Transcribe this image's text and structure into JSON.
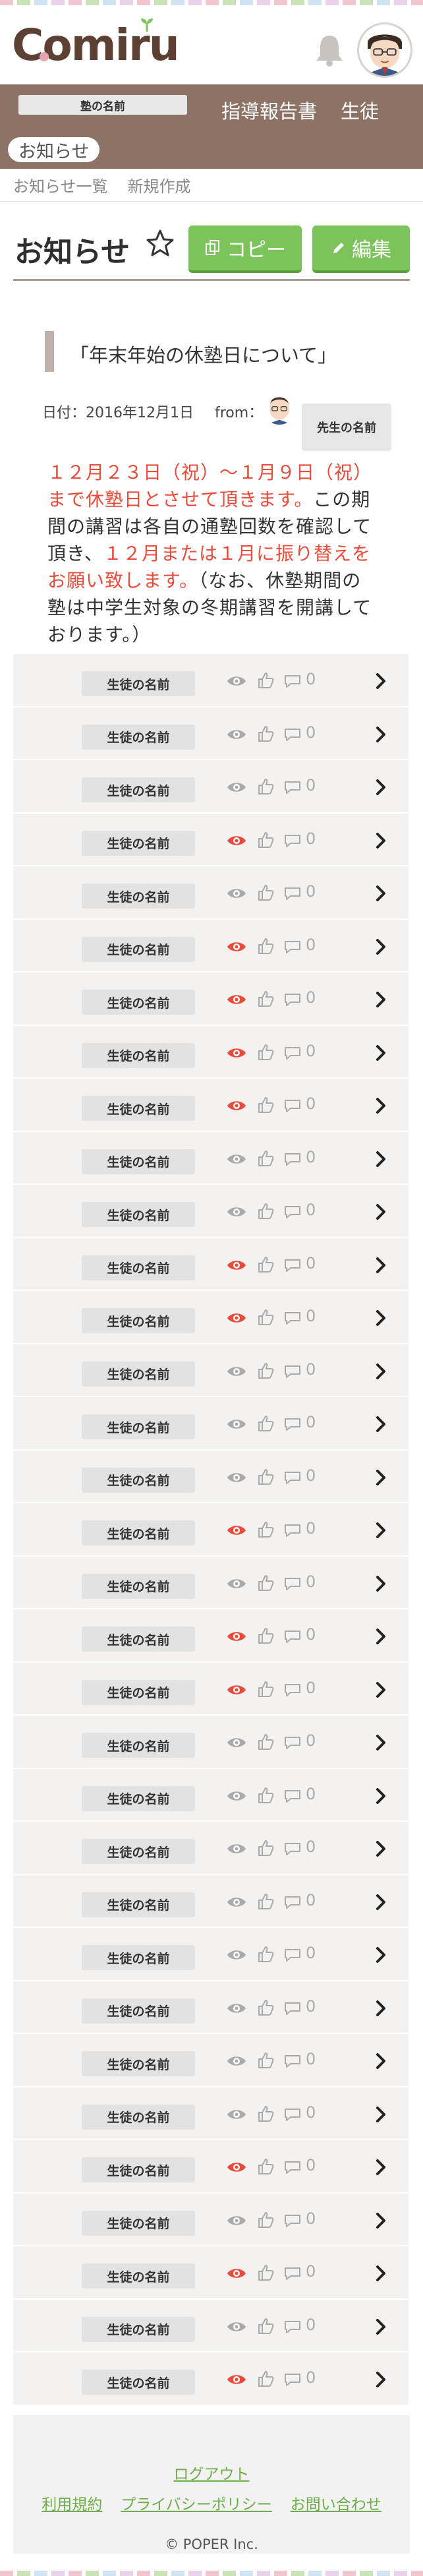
{
  "app": {
    "logo_text": "Comiru",
    "school_name": "塾の名前"
  },
  "nav": {
    "links": [
      "指導報告書",
      "生徒"
    ],
    "active_pill": "お知らせ"
  },
  "subnav": {
    "items": [
      "お知らせ一覧",
      "新規作成"
    ]
  },
  "page": {
    "title": "お知らせ",
    "copy_button": "コピー",
    "edit_button": "編集"
  },
  "notice": {
    "title": "「年末年始の休塾日について」",
    "date": "日付：2016年12月1日",
    "from_label": "from：",
    "teacher_name": "先生の名前",
    "body_red_1": "１２月２３日（祝）〜１月９日（祝）まで休塾日とさせて頂きます。",
    "body_black_1": "この期間の講習は各自の通塾回数を確認して頂き、",
    "body_red_2": "１２月または１月に振り替えをお願い致します。",
    "body_black_2": "（なお、休塾期間の塾は中学生対象の冬期講習を開講しております。）"
  },
  "students": {
    "row_name": "生徒の名前",
    "count_text": "0",
    "colors": {
      "seen": "#e94c3a",
      "unseen": "#aaaaaa"
    },
    "rows": [
      {
        "name": "生徒の名前",
        "seen": false,
        "comments": "0"
      },
      {
        "name": "生徒の名前",
        "seen": false,
        "comments": "0"
      },
      {
        "name": "生徒の名前",
        "seen": false,
        "comments": "0"
      },
      {
        "name": "生徒の名前",
        "seen": true,
        "comments": "0"
      },
      {
        "name": "生徒の名前",
        "seen": false,
        "comments": "0"
      },
      {
        "name": "生徒の名前",
        "seen": true,
        "comments": "0"
      },
      {
        "name": "生徒の名前",
        "seen": true,
        "comments": "0"
      },
      {
        "name": "生徒の名前",
        "seen": true,
        "comments": "0"
      },
      {
        "name": "生徒の名前",
        "seen": true,
        "comments": "0"
      },
      {
        "name": "生徒の名前",
        "seen": false,
        "comments": "0"
      },
      {
        "name": "生徒の名前",
        "seen": false,
        "comments": "0"
      },
      {
        "name": "生徒の名前",
        "seen": true,
        "comments": "0"
      },
      {
        "name": "生徒の名前",
        "seen": true,
        "comments": "0"
      },
      {
        "name": "生徒の名前",
        "seen": false,
        "comments": "0"
      },
      {
        "name": "生徒の名前",
        "seen": false,
        "comments": "0"
      },
      {
        "name": "生徒の名前",
        "seen": false,
        "comments": "0"
      },
      {
        "name": "生徒の名前",
        "seen": true,
        "comments": "0"
      },
      {
        "name": "生徒の名前",
        "seen": false,
        "comments": "0"
      },
      {
        "name": "生徒の名前",
        "seen": true,
        "comments": "0"
      },
      {
        "name": "生徒の名前",
        "seen": true,
        "comments": "0"
      },
      {
        "name": "生徒の名前",
        "seen": false,
        "comments": "0"
      },
      {
        "name": "生徒の名前",
        "seen": false,
        "comments": "0"
      },
      {
        "name": "生徒の名前",
        "seen": false,
        "comments": "0"
      },
      {
        "name": "生徒の名前",
        "seen": false,
        "comments": "0"
      },
      {
        "name": "生徒の名前",
        "seen": false,
        "comments": "0"
      },
      {
        "name": "生徒の名前",
        "seen": false,
        "comments": "0"
      },
      {
        "name": "生徒の名前",
        "seen": false,
        "comments": "0"
      },
      {
        "name": "生徒の名前",
        "seen": false,
        "comments": "0"
      },
      {
        "name": "生徒の名前",
        "seen": true,
        "comments": "0"
      },
      {
        "name": "生徒の名前",
        "seen": false,
        "comments": "0"
      },
      {
        "name": "生徒の名前",
        "seen": true,
        "comments": "0"
      },
      {
        "name": "生徒の名前",
        "seen": false,
        "comments": "0"
      },
      {
        "name": "生徒の名前",
        "seen": true,
        "comments": "0"
      }
    ]
  },
  "footer": {
    "logout": "ログアウト",
    "terms": "利用規約",
    "privacy": "プライバシーポリシー",
    "contact": "お問い合わせ",
    "copyright": "© POPER Inc."
  }
}
